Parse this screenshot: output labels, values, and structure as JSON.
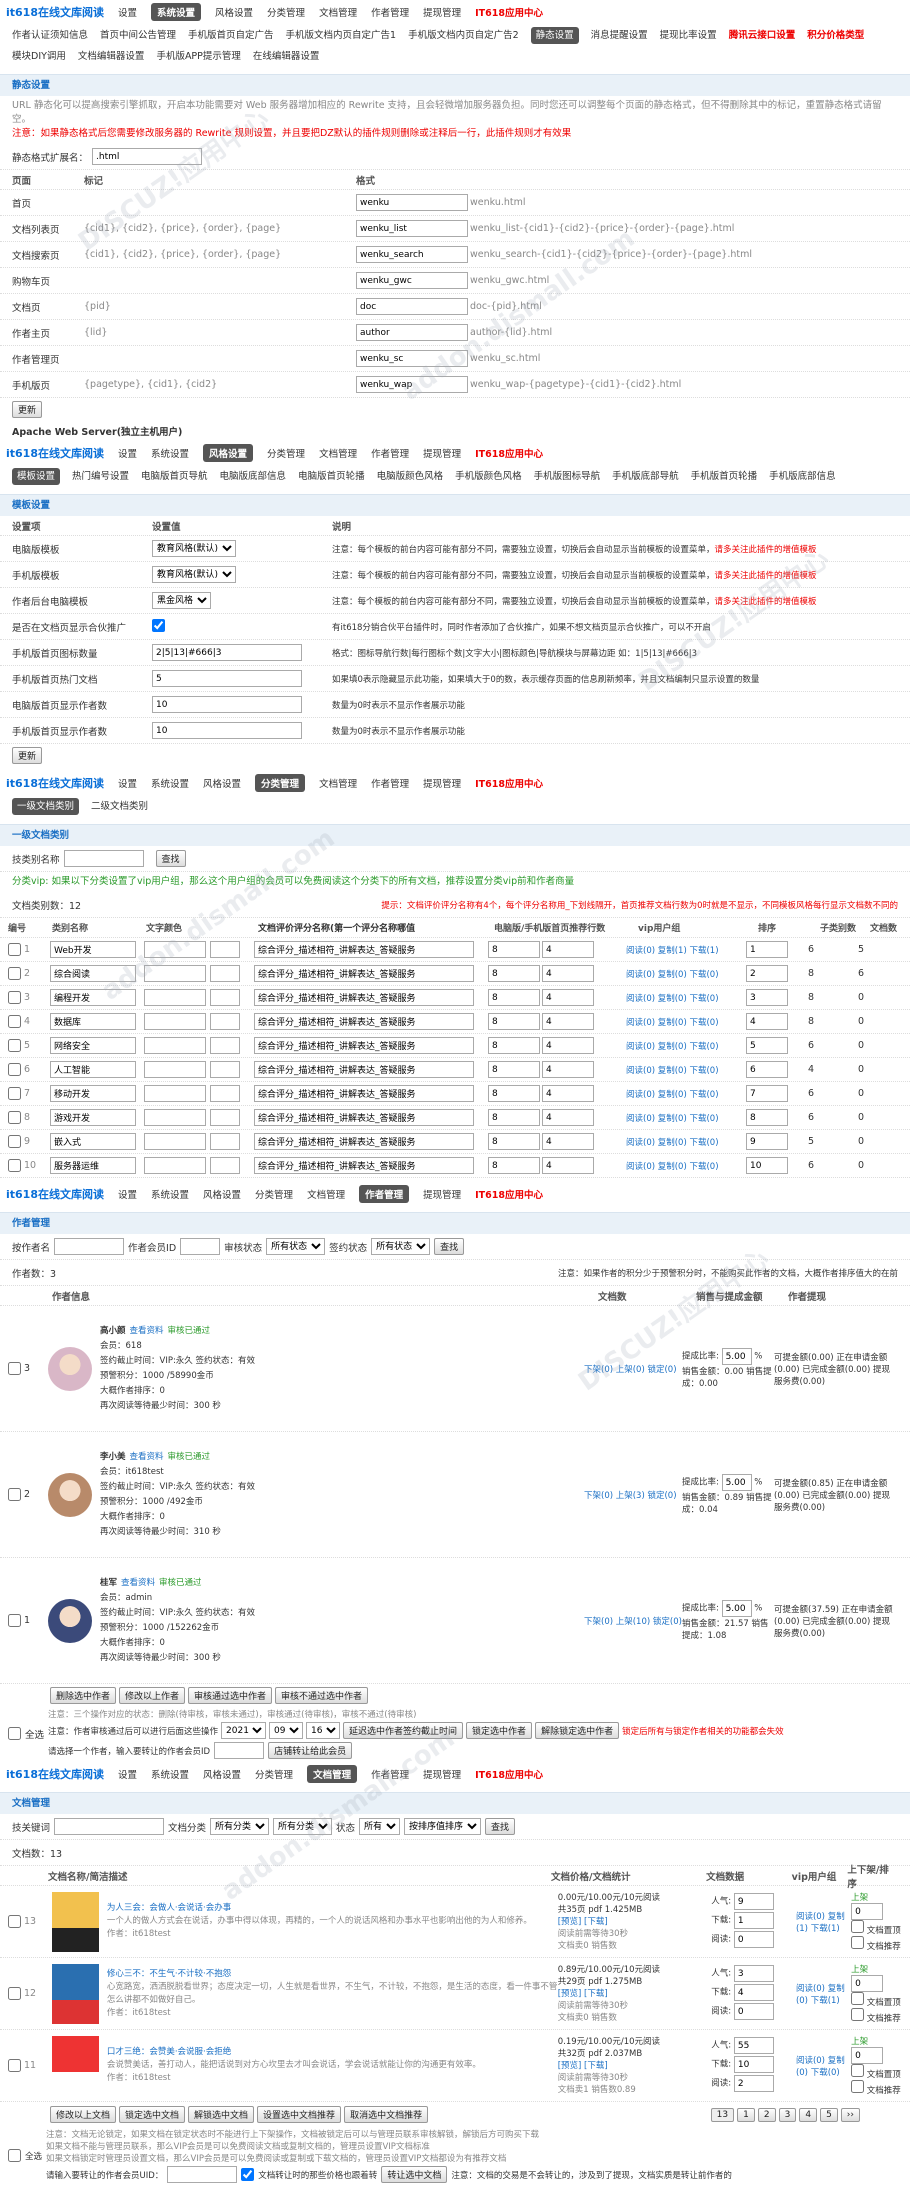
{
  "nav": {
    "brand": "it618在线文库阅读",
    "items": [
      "设置",
      "系统设置",
      "风格设置",
      "分类管理",
      "文档管理",
      "作者管理",
      "提现管理"
    ],
    "app": "IT618应用中心"
  },
  "s1": {
    "sub": [
      "作者认证须知信息",
      "首页中间公告管理",
      "手机版首页自定广告",
      "手机版文档内页自定广告1",
      "手机版文档内页自定广告2",
      "静态设置",
      "消息提醒设置",
      "提现比率设置",
      "腾讯云接口设置",
      "积分价格类型",
      "模块DIY调用",
      "文档编辑器设置",
      "手机版APP提示管理",
      "在线编辑器设置"
    ],
    "sub_active": 5,
    "sub_red": [
      8,
      9
    ],
    "head": "静态设置",
    "note1": "URL 静态化可以提高搜索引擎抓取，开启本功能需要对 Web 服务器增加相应的 Rewrite 支持，且会轻微增加服务器负担。同时您还可以调整每个页面的静态格式，但不得删除其中的标记，重置静态格式请留空。",
    "note2": "注意：如果静态格式后您需要修改服务器的 Rewrite 规则设置，并且要把DZ默认的插件规则删除或注释后一行，此插件规则才有效果",
    "ext_label": "静态格式扩展名：",
    "ext_value": ".html",
    "cols": [
      "页面",
      "标记",
      "格式"
    ],
    "rows": [
      {
        "page": "首页",
        "mark": "",
        "val": "wenku",
        "res": "wenku.html"
      },
      {
        "page": "文档列表页",
        "mark": "{cid1}, {cid2}, {price}, {order}, {page}",
        "val": "wenku_list",
        "res": "wenku_list-{cid1}-{cid2}-{price}-{order}-{page}.html"
      },
      {
        "page": "文档搜索页",
        "mark": "{cid1}, {cid2}, {price}, {order}, {page}",
        "val": "wenku_search",
        "res": "wenku_search-{cid1}-{cid2}-{price}-{order}-{page}.html"
      },
      {
        "page": "购物车页",
        "mark": "",
        "val": "wenku_gwc",
        "res": "wenku_gwc.html"
      },
      {
        "page": "文档页",
        "mark": "{pid}",
        "val": "doc",
        "res": "doc-{pid}.html"
      },
      {
        "page": "作者主页",
        "mark": "{lid}",
        "val": "author",
        "res": "author-{lid}.html"
      },
      {
        "page": "作者管理页",
        "mark": "",
        "val": "wenku_sc",
        "res": "wenku_sc.html"
      },
      {
        "page": "手机版页",
        "mark": "{pagetype}, {cid1}, {cid2}",
        "val": "wenku_wap",
        "res": "wenku_wap-{pagetype}-{cid1}-{cid2}.html"
      }
    ],
    "submit": "更新",
    "apache": "Apache Web Server(独立主机用户)"
  },
  "s2": {
    "sub": [
      "模板设置",
      "热门编号设置",
      "电脑版首页导航",
      "电脑版底部信息",
      "电脑版首页轮播",
      "电脑版颜色风格",
      "手机版颜色风格",
      "手机版图标导航",
      "手机版底部导航",
      "手机版首页轮播",
      "手机版底部信息"
    ],
    "head": "模板设置",
    "cols": [
      "设置项",
      "设置值",
      "说明"
    ],
    "rows": [
      {
        "k": "电脑版模板",
        "v": "教育风格(默认)",
        "d": "注意：每个模板的前台内容可能有部分不同，需要独立设置，切换后会自动显示当前模板的设置菜单，",
        "r": "请多关注此插件的增值模板"
      },
      {
        "k": "手机版模板",
        "v": "教育风格(默认)",
        "d": "注意：每个模板的前台内容可能有部分不同，需要独立设置，切换后会自动显示当前模板的设置菜单，",
        "r": "请多关注此插件的增值模板"
      },
      {
        "k": "作者后台电脑模板",
        "v": "黑金风格",
        "d": "注意：每个模板的前台内容可能有部分不同，需要独立设置，切换后会自动显示当前模板的设置菜单，",
        "r": "请多关注此插件的增值模板"
      },
      {
        "k": "是否在文档页显示合伙推广",
        "v": "",
        "d": "有it618分销合伙平台插件时，同时作者添加了合伙推广，如果不想文档页显示合伙推广，可以不开启",
        "r": ""
      },
      {
        "k": "手机版首页图标数量",
        "v": "2|5|13|#666|3",
        "d": "格式：图标导航行数|每行图标个数|文字大小|图标颜色|导航模块与屏幕边距 如：1|5|13|#666|3",
        "r": ""
      },
      {
        "k": "手机版首页热门文档",
        "v": "5",
        "d": "如果填0表示隐藏显示此功能，如果填大于0的数，表示缓存页面的信息刷新频率，并且文档编制只显示设置的数量",
        "r": ""
      },
      {
        "k": "电脑版首页显示作者数",
        "v": "10",
        "d": "数量为0时表示不显示作者展示功能",
        "r": ""
      },
      {
        "k": "手机版首页显示作者数",
        "v": "10",
        "d": "数量为0时表示不显示作者展示功能",
        "r": ""
      }
    ],
    "submit": "更新"
  },
  "s3": {
    "tabs": [
      "一级文档类别",
      "二级文档类别"
    ],
    "head": "一级文档类别",
    "search_label": "技类别名称",
    "search_btn": "查找",
    "vip_note": "分类vip: 如果以下分类设置了vip用户组，那么这个用户组的会员可以免费阅读这个分类下的所有文档，推荐设置分类vip前和作者商量",
    "count_label": "文档类别数：12",
    "tip": "提示：文档评价评分名称有4个，每个评分名称用_下划线隔开，首页推荐文档行数为0时就是不显示，不同模板风格每行显示文档数不同的",
    "cols": [
      "编号",
      "类别名称",
      "文字颜色",
      "文档评价评分名称(第一个评分名称哪值",
      "电脑版/手机版首页推荐行数",
      "vip用户组",
      "排序",
      "子类别数",
      "文档数"
    ],
    "rows": [
      {
        "id": "1",
        "name": "Web开发",
        "score": "综合评分_描述相符_讲解表达_答疑服务",
        "r1": "8",
        "r2": "4",
        "v": "阅读(0) 复制(1) 下载(1)",
        "sort": "1",
        "sub": "6",
        "docs": "5"
      },
      {
        "id": "2",
        "name": "综合阅读",
        "score": "综合评分_描述相符_讲解表达_答疑服务",
        "r1": "8",
        "r2": "4",
        "v": "阅读(0) 复制(0) 下载(0)",
        "sort": "2",
        "sub": "8",
        "docs": "6"
      },
      {
        "id": "3",
        "name": "编程开发",
        "score": "综合评分_描述相符_讲解表达_答疑服务",
        "r1": "8",
        "r2": "4",
        "v": "阅读(0) 复制(0) 下载(0)",
        "sort": "3",
        "sub": "8",
        "docs": "0"
      },
      {
        "id": "4",
        "name": "数据库",
        "score": "综合评分_描述相符_讲解表达_答疑服务",
        "r1": "8",
        "r2": "4",
        "v": "阅读(0) 复制(0) 下载(0)",
        "sort": "4",
        "sub": "8",
        "docs": "0"
      },
      {
        "id": "5",
        "name": "网络安全",
        "score": "综合评分_描述相符_讲解表达_答疑服务",
        "r1": "8",
        "r2": "4",
        "v": "阅读(0) 复制(0) 下载(0)",
        "sort": "5",
        "sub": "6",
        "docs": "0"
      },
      {
        "id": "6",
        "name": "人工智能",
        "score": "综合评分_描述相符_讲解表达_答疑服务",
        "r1": "8",
        "r2": "4",
        "v": "阅读(0) 复制(0) 下载(0)",
        "sort": "6",
        "sub": "4",
        "docs": "0"
      },
      {
        "id": "7",
        "name": "移动开发",
        "score": "综合评分_描述相符_讲解表达_答疑服务",
        "r1": "8",
        "r2": "4",
        "v": "阅读(0) 复制(0) 下载(0)",
        "sort": "7",
        "sub": "6",
        "docs": "0"
      },
      {
        "id": "8",
        "name": "游戏开发",
        "score": "综合评分_描述相符_讲解表达_答疑服务",
        "r1": "8",
        "r2": "4",
        "v": "阅读(0) 复制(0) 下载(0)",
        "sort": "8",
        "sub": "6",
        "docs": "0"
      },
      {
        "id": "9",
        "name": "嵌入式",
        "score": "综合评分_描述相符_讲解表达_答疑服务",
        "r1": "8",
        "r2": "4",
        "v": "阅读(0) 复制(0) 下载(0)",
        "sort": "9",
        "sub": "5",
        "docs": "0"
      },
      {
        "id": "10",
        "name": "服务器运维",
        "score": "综合评分_描述相符_讲解表达_答疑服务",
        "r1": "8",
        "r2": "4",
        "v": "阅读(0) 复制(0) 下载(0)",
        "sort": "10",
        "sub": "6",
        "docs": "0"
      }
    ]
  },
  "s4": {
    "head": "作者管理",
    "f1": "按作者名",
    "f2": "作者会员ID",
    "f3": "审核状态",
    "f3v": "所有状态",
    "f4": "签约状态",
    "f4v": "所有状态",
    "btn": "查找",
    "count": "作者数：3",
    "note": "注意：如果作者的积分少于预警积分时，不能购买此作者的文档，大概作者排序值大的在前",
    "cols": [
      "作者信息",
      "文档数",
      "销售与提成金额",
      "作者提现"
    ],
    "authors": [
      {
        "name": "高小颜",
        "view": "查看资料",
        "status": "审核已通过",
        "member": "会员：618",
        "vip": "签约截止时间：VIP:永久 签约状态：有效",
        "warn": "预警积分：1000 /58990金币",
        "sort": "大概作者排序：0",
        "time": "再次阅读等待最少时间：300 秒",
        "docs": "下架(0) 上架(0) 锁定(0)",
        "rate": "5.00",
        "sales": "销售金额：0.00 销售提成：0.00",
        "cash": "可提金额(0.00) 正在申请金额(0.00) 已完成金额(0.00) 提现服务费(0.00)"
      },
      {
        "name": "李小美",
        "view": "查看资料",
        "status": "审核已通过",
        "member": "会员：it618test",
        "vip": "签约截止时间：VIP:永久 签约状态：有效",
        "warn": "预警积分：1000 /492金币",
        "sort": "大概作者排序：0",
        "time": "再次阅读等待最少时间：310 秒",
        "docs": "下架(0) 上架(3) 锁定(0)",
        "rate": "5.00",
        "sales": "销售金额：0.89 销售提成：0.04",
        "cash": "可提金额(0.85) 正在申请金额(0.00) 已完成金额(0.00) 提现服务费(0.00)"
      },
      {
        "name": "桂军",
        "view": "查看资料",
        "status": "审核已通过",
        "member": "会员：admin",
        "vip": "签约截止时间：VIP:永久 签约状态：有效",
        "warn": "预警积分：1000 /152262金币",
        "sort": "大概作者排序：0",
        "time": "再次阅读等待最少时间：300 秒",
        "docs": "下架(0) 上架(10) 锁定(0)",
        "rate": "5.00",
        "sales": "销售金额：21.57 销售提成：1.08",
        "cash": "可提金额(37.59) 正在申请金额(0.00) 已完成金额(0.00) 提现服务费(0.00)"
      }
    ],
    "actions": [
      "删除选中作者",
      "修改以上作者",
      "审核通过选中作者",
      "审核不通过选中作者"
    ],
    "foot1": "注意：三个操作对应的状态：删除(待审核，审核未通过)，审核通过(待审核)，审核不通过(待审核)",
    "foot2": "注意：作者审核通过后可以进行后面这些操作",
    "y": "2021",
    "m": "09",
    "d": "16",
    "b1": "延迟选中作者签约截止时间",
    "b2": "锁定选中作者",
    "b3": "解除锁定选中作者",
    "red": "锁定后所有与锁定作者相关的功能都会失效",
    "all": "全选",
    "merge": "请选择一个作者，输入要转让的作者会员ID",
    "merge_btn": "店铺转让给此会员"
  },
  "s5": {
    "head": "文档管理",
    "f1": "技关键词",
    "f2": "文档分类",
    "f2v": "所有分类",
    "f2b": "所有分类",
    "f3": "状态",
    "f3v": "所有",
    "f4": "按排序值排序",
    "btn": "查找",
    "count": "文档数：13",
    "cols": [
      "文档名称/简洁描述",
      "文档价格/文档统计",
      "文档数据",
      "vip用户组",
      "上下架/排序"
    ],
    "docs": [
      {
        "id": "13",
        "title": "为人三会：会做人·会说话·会办事",
        "desc": "一个人的做人方式会在说话，办事中得以体现，再精的，一个人的说话风格和办事水平也影响出他的为人和修养。",
        "author": "作者：it618test",
        "price": "0.00元/10.00元/10元阅读",
        "size": "共35页 pdf 1.425MB",
        "links": "[预览] [下载]",
        "free": "阅读前需等待30秒",
        "sold": "文档卖0 销售数",
        "n1": "9",
        "n2": "1",
        "n3": "0",
        "vip": "阅读(0) 复制(1) 下载(1)",
        "sort": "0",
        "cover": "#f2c14e",
        "cover2": "#222"
      },
      {
        "id": "12",
        "title": "修心三不：不生气·不计较·不抱怨",
        "desc": "心宽路宽，洒洒脱脱看世界；态度决定一切，人生就是看世界，不生气，不计较，不抱怨，是生活的态度，看一件事不管怎么讲都不如做好自己。",
        "author": "作者：it618test",
        "price": "0.89元/10.00元/10元阅读",
        "size": "共29页 pdf 1.275MB",
        "links": "[预览] [下载]",
        "free": "阅读前需等待30秒",
        "sold": "文档卖0 销售数",
        "n1": "3",
        "n2": "4",
        "n3": "0",
        "vip": "阅读(0) 复制(0) 下载(1)",
        "sort": "0",
        "cover": "#2a6fb0",
        "cover2": "#d33"
      },
      {
        "id": "11",
        "title": "口才三绝：会赞美·会说服·会拒绝",
        "desc": "会说赞美话，善打动人，能把话说到对方心坎里去才叫会说话，学会说话就能让你的沟通更有效率。",
        "author": "作者：it618test",
        "price": "0.19元/10.00元/10元阅读",
        "size": "共32页 pdf 2.037MB",
        "links": "[预览] [下载]",
        "free": "阅读前需等待30秒",
        "sold": "文档卖1 销售数0.89",
        "n1": "55",
        "n2": "10",
        "n3": "2",
        "vip": "阅读(0) 复制(0) 下载(0)",
        "sort": "0",
        "cover": "#e33",
        "cover2": "#fff"
      }
    ],
    "actions": [
      "修改以上文档",
      "锁定选中文档",
      "解锁选中文档",
      "设置选中文档推荐",
      "取消选中文档推荐"
    ],
    "pager": [
      "13",
      "1",
      "2",
      "3",
      "4",
      "5",
      "››"
    ],
    "n1": "注意：文档无论锁定，如果文档在锁定状态时不能进行上下架操作，文档被锁定后可以与管理员联系审核解锁，解锁后方可购买下载",
    "n2": "如果文档不能与管理员联系，那么VIP会员是可以免费阅读文档或复制文档的，管理员设置VIP文档标准",
    "n3": "如果文档锁定时管理员设置文档，那么VIP会员是可以免费阅读或复制或下载文档的，管理员设置VIP文档都设为有推荐文档",
    "all": "全选",
    "transfer": "请输入要转让的作者会员UID：",
    "chk": "文档转让时的那些价格也跟着转",
    "tbtn": "转让选中文档",
    "tnote": "注意：文档的交易是不会转让的，涉及到了提现，文档实质是转让前作者的"
  }
}
